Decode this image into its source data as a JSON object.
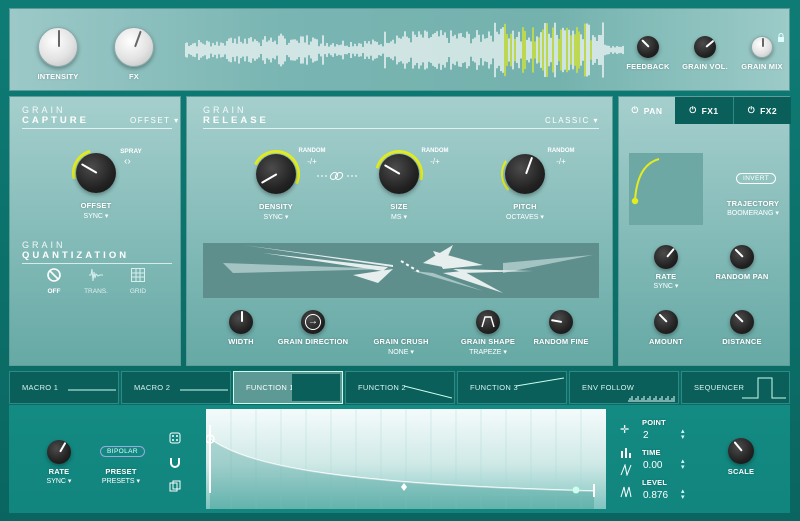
{
  "top": {
    "intensity_label": "INTENSITY",
    "fx_label": "FX",
    "feedback_label": "FEEDBACK",
    "grain_vol_label": "GRAIN VOL.",
    "grain_mix_label": "GRAIN MIX"
  },
  "capture": {
    "title_line1": "GRAIN",
    "title_line2": "CAPTURE",
    "mode": "OFFSET",
    "spray_label": "SPRAY",
    "offset_label": "OFFSET",
    "offset_sub": "SYNC"
  },
  "quantization": {
    "title_line1": "GRAIN",
    "title_line2": "QUANTIZATION",
    "options": [
      "OFF",
      "TRANS.",
      "GRID"
    ]
  },
  "release": {
    "title_line1": "GRAIN",
    "title_line2": "RELEASE",
    "mode": "CLASSIC",
    "random_label": "RANDOM",
    "random_value": "-/+",
    "density_label": "DENSITY",
    "density_sub": "SYNC",
    "size_label": "SIZE",
    "size_sub": "MS",
    "pitch_label": "PITCH",
    "pitch_sub": "OCTAVES",
    "width_label": "WIDTH",
    "direction_label": "GRAIN DIRECTION",
    "crush_label": "GRAIN CRUSH",
    "crush_sub": "NONE",
    "shape_label": "GRAIN SHAPE",
    "shape_sub": "TRAPEZE",
    "random_fine_label": "RANDOM FINE"
  },
  "pan": {
    "tabs": [
      "PAN",
      "FX1",
      "FX2"
    ],
    "invert_label": "INVERT",
    "trajectory_label": "TRAJECTORY",
    "trajectory_sub": "BOOMERANG",
    "rate_label": "RATE",
    "rate_sub": "SYNC",
    "random_pan_label": "RANDOM PAN",
    "amount_label": "AMOUNT",
    "distance_label": "DISTANCE"
  },
  "mod_slots": [
    "MACRO 1",
    "MACRO 2",
    "FUNCTION 1",
    "FUNCTION 2",
    "FUNCTION 3",
    "ENV FOLLOW",
    "SEQUENCER"
  ],
  "function": {
    "rate_label": "RATE",
    "rate_sub": "SYNC",
    "bipolar_label": "BIPOLAR",
    "preset_label": "PRESET",
    "preset_sub": "PRESETS",
    "point_label": "POINT",
    "point_value": "2",
    "time_label": "TIME",
    "time_value": "0.00",
    "level_label": "LEVEL",
    "level_value": "0.876",
    "scale_label": "SCALE"
  },
  "icons": {
    "dropdown": "chevron-down",
    "link": "link",
    "dice": "dice",
    "magnet": "magnet",
    "copy": "copy"
  },
  "colors": {
    "accent_yellow": "#e3ec1f",
    "panel_teal": "#7fb8b5",
    "dark_teal": "#0a5f5a"
  }
}
